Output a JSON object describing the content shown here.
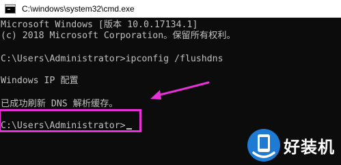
{
  "window": {
    "title": "C:\\windows\\system32\\cmd.exe"
  },
  "console": {
    "lines": [
      "Microsoft Windows [版本 10.0.17134.1]",
      "(c) 2018 Microsoft Corporation。保留所有权利。",
      "",
      "C:\\Users\\Administrator>ipconfig /flushdns",
      "",
      "Windows IP 配置",
      "",
      "已成功刷新 DNS 解析缓存。",
      "",
      "C:\\Users\\Administrator>"
    ]
  },
  "annotation": {
    "color": "#e832d8"
  },
  "watermark": {
    "text": "好装机",
    "brand_color": "#1e7ad2"
  }
}
